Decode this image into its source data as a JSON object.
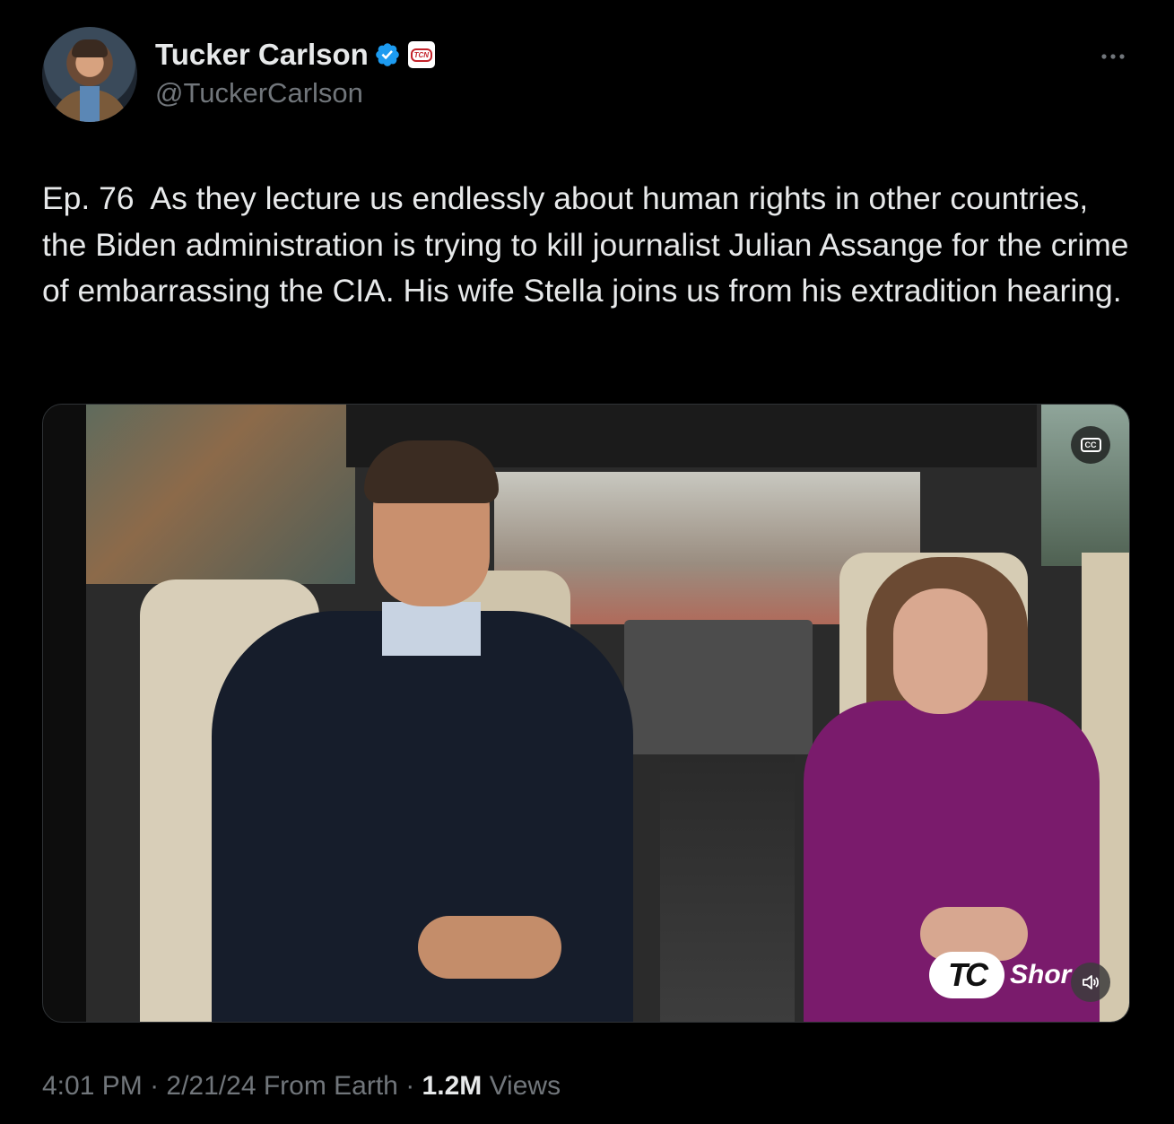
{
  "author": {
    "name": "Tucker Carlson",
    "handle": "@TuckerCarlson",
    "affiliate_badge_text": "TCN",
    "verified_color": "#1d9bf0"
  },
  "tweet": {
    "text": "Ep. 76  As they lecture us endlessly about human rights in other countries, the Biden administration is trying to kill journalist Julian Assange for the crime of embarrassing the CIA. His wife Stella joins us from his extradition hearing."
  },
  "media": {
    "cc_label": "CC",
    "logo_mark": "TC",
    "logo_text": "Shor"
  },
  "meta": {
    "time": "4:01 PM",
    "sep1": " · ",
    "date": "2/21/24",
    "source": " From Earth",
    "sep2": " · ",
    "views_count": "1.2M",
    "views_label": " Views"
  },
  "icons": [
    "verified-icon",
    "more-icon",
    "cc-icon",
    "volume-icon"
  ]
}
